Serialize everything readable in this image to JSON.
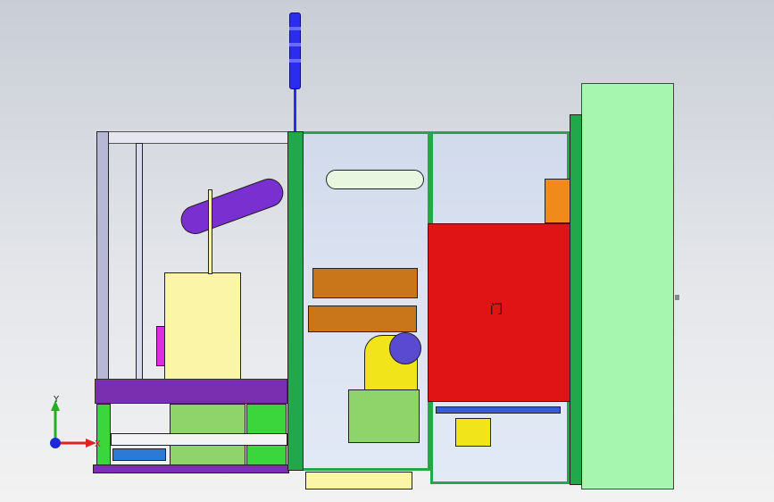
{
  "viewport": {
    "door_label": "门",
    "triad": {
      "y_label": "Y",
      "x_label": "X"
    }
  },
  "colors": {
    "background_top": "#c9cdd6",
    "background_bottom": "#f2f2f2",
    "cabinet": "#a6f6b0",
    "door": "#e01414",
    "frame_green": "#22a84a",
    "frame_blue": "#3b5bd6",
    "robot_yellow": "#f2e41a",
    "purple_arm": "#7a2fd1",
    "beige_panel": "#fbf5a8",
    "light_green": "#8fd36b",
    "signal_tower": "#2c2cf0"
  }
}
